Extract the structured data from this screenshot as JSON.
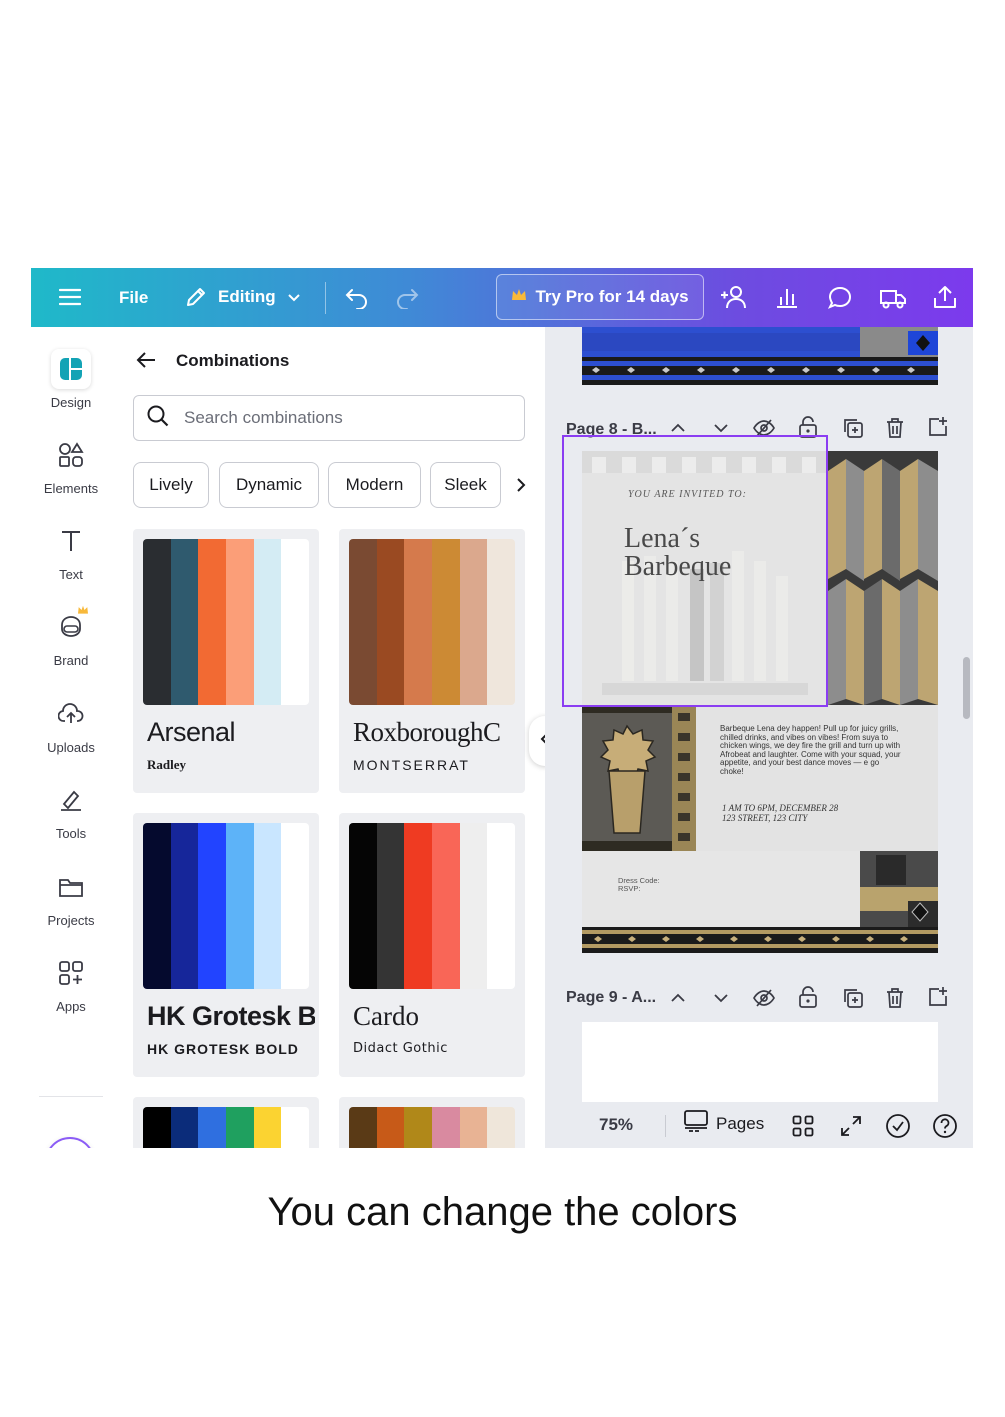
{
  "topbar": {
    "file_label": "File",
    "editing_label": "Editing",
    "try_pro_label": "Try Pro for 14 days"
  },
  "rail": {
    "items": [
      {
        "label": "Design",
        "icon": "design-icon"
      },
      {
        "label": "Elements",
        "icon": "elements-icon"
      },
      {
        "label": "Text",
        "icon": "text-icon"
      },
      {
        "label": "Brand",
        "icon": "brand-icon"
      },
      {
        "label": "Uploads",
        "icon": "uploads-icon"
      },
      {
        "label": "Tools",
        "icon": "tools-icon"
      },
      {
        "label": "Projects",
        "icon": "projects-icon"
      },
      {
        "label": "Apps",
        "icon": "apps-icon"
      }
    ]
  },
  "panel": {
    "title": "Combinations",
    "search_placeholder": "Search combinations",
    "chips": [
      "Lively",
      "Dynamic",
      "Modern",
      "Sleek"
    ],
    "cards": [
      {
        "font1": "Arsenal",
        "font2": "Radley",
        "colors": [
          "#2a2d31",
          "#2f5a6e",
          "#f26a33",
          "#fb9e78",
          "#d4ecf4",
          "#ffffff"
        ]
      },
      {
        "font1": "RoxboroughC",
        "font2": "MONTSERRAT",
        "colors": [
          "#7a4a32",
          "#9a4a22",
          "#d57a4c",
          "#cc8a34",
          "#dba88d",
          "#efe6dc"
        ]
      },
      {
        "font1": "HK Grotesk B",
        "font2": "HK GROTESK BOLD",
        "colors": [
          "#050a2e",
          "#16269a",
          "#2244ff",
          "#5db3f8",
          "#c9e6ff",
          "#ffffff"
        ]
      },
      {
        "font1": "Cardo",
        "font2": "Didact Gothic",
        "colors": [
          "#050505",
          "#343434",
          "#ef3b22",
          "#f96657",
          "#eeeeee",
          "#ffffff"
        ]
      },
      {
        "colors": [
          "#000000",
          "#0b2c7a",
          "#2f6fe0",
          "#1fa05f",
          "#fbd331",
          "#ffffff"
        ]
      },
      {
        "colors": [
          "#5a3a16",
          "#c75a18",
          "#b08819",
          "#d98aa0",
          "#e8b394",
          "#efe6da"
        ]
      }
    ]
  },
  "canvas": {
    "page8_title": "Page 8 - B...",
    "page9_title": "Page 9 - A...",
    "invite": {
      "invited": "YOU ARE INVITED TO:",
      "name_line1": "Lena´s",
      "name_line2": "Barbeque",
      "body": "Barbeque Lena dey happen! Pull up for juicy grills, chilled drinks, and vibes on vibes! From suya to chicken wings, we dey fire the grill and turn up with Afrobeat and laughter. Come with your squad, your appetite, and your best dance moves — e go choke!",
      "time": "1 AM TO 6PM, DECEMBER 28",
      "address": "123 STREET, 123 CITY",
      "dress": "Dress Code:",
      "rsvp": "RSVP:"
    },
    "zoom": "75%",
    "pages_label": "Pages"
  },
  "caption": "You can change the colors",
  "colors": {
    "accent": "#8b3df2",
    "gradient_start": "#1fb9c9",
    "gradient_end": "#7c3aed"
  }
}
